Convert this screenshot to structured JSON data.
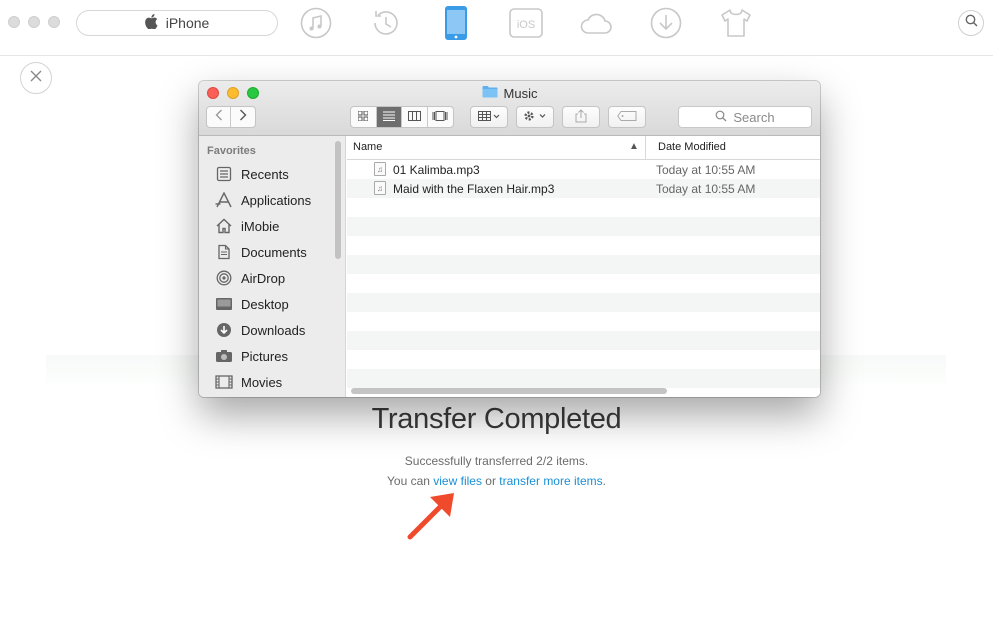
{
  "app": {
    "device_name": "iPhone",
    "nav_icons": [
      "music-icon",
      "history-icon",
      "phone-icon",
      "ios-icon",
      "cloud-icon",
      "download-icon",
      "tshirt-icon"
    ],
    "accent_color": "#1a8fd6"
  },
  "finder": {
    "title": "Music",
    "search_placeholder": "Search",
    "sidebar": {
      "heading": "Favorites",
      "items": [
        {
          "label": "Recents",
          "icon": "recents-icon"
        },
        {
          "label": "Applications",
          "icon": "applications-icon"
        },
        {
          "label": "iMobie",
          "icon": "home-icon"
        },
        {
          "label": "Documents",
          "icon": "documents-icon"
        },
        {
          "label": "AirDrop",
          "icon": "airdrop-icon"
        },
        {
          "label": "Desktop",
          "icon": "desktop-icon"
        },
        {
          "label": "Downloads",
          "icon": "downloads-icon"
        },
        {
          "label": "Pictures",
          "icon": "pictures-icon"
        },
        {
          "label": "Movies",
          "icon": "movies-icon"
        }
      ]
    },
    "columns": {
      "name": "Name",
      "date": "Date Modified"
    },
    "files": [
      {
        "name": "01 Kalimba.mp3",
        "date": "Today at 10:55 AM"
      },
      {
        "name": "Maid with the Flaxen Hair.mp3",
        "date": "Today at 10:55 AM"
      }
    ]
  },
  "result": {
    "title": "Transfer Completed",
    "subtitle": "Successfully transferred 2/2 items.",
    "links_prefix": "You can ",
    "view_files": "view files",
    "links_middle": " or ",
    "transfer_more": "transfer more items",
    "links_suffix": "."
  }
}
